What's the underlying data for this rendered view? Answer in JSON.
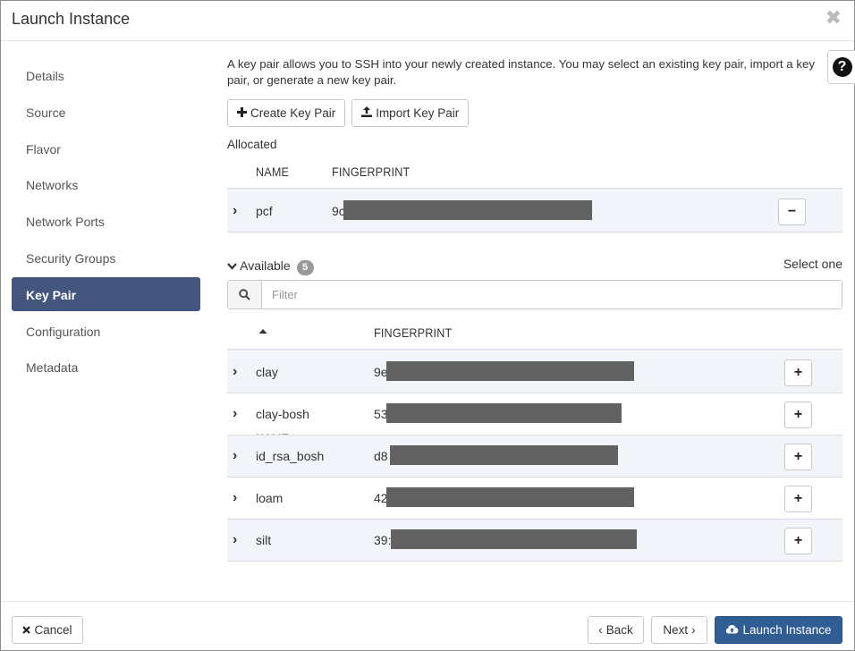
{
  "modal": {
    "title": "Launch Instance",
    "close_symbol": "✖"
  },
  "sidebar": {
    "items": [
      {
        "label": "Details"
      },
      {
        "label": "Source"
      },
      {
        "label": "Flavor"
      },
      {
        "label": "Networks"
      },
      {
        "label": "Network Ports"
      },
      {
        "label": "Security Groups"
      },
      {
        "label": "Key Pair",
        "active": true
      },
      {
        "label": "Configuration"
      },
      {
        "label": "Metadata"
      }
    ]
  },
  "help": {
    "symbol": "?"
  },
  "keypair": {
    "intro": "A key pair allows you to SSH into your newly created instance. You may select an existing key pair, import a key pair, or generate a new key pair.",
    "create_label": "Create Key Pair",
    "import_label": "Import Key Pair",
    "allocated_label": "Allocated",
    "allocated_headers": {
      "name": "NAME",
      "fingerprint": "FINGERPRINT"
    },
    "allocated_rows": [
      {
        "name": "pcf",
        "fingerprint": "9c"
      }
    ],
    "available_label": "Available",
    "available_count": "5",
    "select_one": "Select one",
    "filter_placeholder": "Filter",
    "available_headers": {
      "name": "NAME",
      "fingerprint": "FINGERPRINT"
    },
    "available_rows": [
      {
        "name": "clay",
        "fingerprint": "9e"
      },
      {
        "name": "clay-bosh",
        "fingerprint": "53"
      },
      {
        "name": "id_rsa_bosh",
        "fingerprint": "d8"
      },
      {
        "name": "loam",
        "fingerprint": "42"
      },
      {
        "name": "silt",
        "fingerprint": "39:"
      }
    ]
  },
  "footer": {
    "cancel_label": "Cancel",
    "back_label": "Back",
    "next_label": "Next",
    "launch_label": "Launch Instance"
  }
}
